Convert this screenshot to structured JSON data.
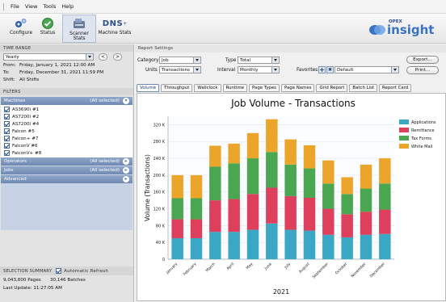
{
  "menu": {
    "items": [
      "File",
      "View",
      "Tools",
      "Help"
    ]
  },
  "toolbar": {
    "buttons": [
      {
        "label": "Configure",
        "icon": "configure-icon"
      },
      {
        "label": "Status",
        "icon": "status-icon"
      },
      {
        "label": "Scanner Stats",
        "icon": "scanner-stats-icon"
      },
      {
        "label": "Machine Stats",
        "icon": "machine-stats-icon",
        "glyph": "DNS"
      }
    ],
    "logo": {
      "small": "OPEX",
      "big": "insight",
      "mark": "opex-logo-icon"
    }
  },
  "left": {
    "time_range": {
      "header": "TIME RANGE",
      "preset": "Yearly",
      "prev": "<",
      "next": ">",
      "from_label": "From:",
      "from_value": "Friday, January 1, 2021 12:00 AM",
      "to_label": "To:",
      "to_value": "Friday, December 31, 2021 11:59 PM",
      "shift_label": "Shift:",
      "shift_value": "All Shifts"
    },
    "filters": {
      "header": "FILTERS",
      "machines": {
        "label": "Machines",
        "summary": "(All selected)",
        "items": [
          "AS3690i #1",
          "AS7200i #2",
          "AS7200i #4",
          "Falcon #5",
          "Falcon+ #7",
          "FalconV #6",
          "FalconV+ #8"
        ]
      },
      "operators": {
        "label": "Operators",
        "summary": "(All selected)"
      },
      "jobs": {
        "label": "Jobs",
        "summary": "(All selected)"
      },
      "advanced": {
        "label": "Advanced"
      }
    },
    "summary": {
      "header": "SELECTION SUMMARY",
      "auto_refresh": "Automatic Refresh",
      "pages": "9,043,800 Pages",
      "batches": "30,146 Batches",
      "last_update": "Last Update: 11:27:05 AM"
    }
  },
  "settings": {
    "header": "Report Settings",
    "category_label": "Category",
    "category_value": "Job",
    "type_label": "Type",
    "type_value": "Total",
    "units_label": "Units",
    "units_value": "Transactions",
    "interval_label": "Interval",
    "interval_value": "Monthly",
    "favorites_label": "Favorites",
    "favorites_value": "Default",
    "add": "+",
    "remove": "✖",
    "export": "Export...",
    "print": "Print..."
  },
  "tabs": [
    "Volume",
    "Throughput",
    "Wallclock",
    "Runtime",
    "Page Types",
    "Page Names",
    "Grid Report",
    "Batch List",
    "Report Card"
  ],
  "active_tab": "Volume",
  "chart_data": {
    "type": "bar",
    "stacked": true,
    "title": "Job Volume - Transactions",
    "xlabel": "2021",
    "ylabel": "Volume (Transactions)",
    "ylim": [
      0,
      340000
    ],
    "ytick_labels": [
      "0",
      "40 K",
      "80 K",
      "120 K",
      "160 K",
      "200 K",
      "240 K",
      "280 K",
      "320 K"
    ],
    "categories": [
      "January",
      "February",
      "March",
      "April",
      "May",
      "June",
      "July",
      "August",
      "September",
      "October",
      "November",
      "December"
    ],
    "series": [
      {
        "name": "Applications",
        "color": "#3aa7c5",
        "values": [
          50000,
          50000,
          65000,
          65000,
          70000,
          85000,
          70000,
          68000,
          58000,
          52000,
          58000,
          60000
        ]
      },
      {
        "name": "Remittance",
        "color": "#de3f5c",
        "values": [
          45000,
          45000,
          75000,
          78000,
          85000,
          85000,
          80000,
          78000,
          62000,
          55000,
          55000,
          58000
        ]
      },
      {
        "name": "Tax Forms",
        "color": "#4aa651",
        "values": [
          50000,
          50000,
          80000,
          85000,
          85000,
          85000,
          75000,
          70000,
          60000,
          48000,
          55000,
          62000
        ]
      },
      {
        "name": "White Mail",
        "color": "#eaa52a",
        "values": [
          55000,
          55000,
          50000,
          47000,
          60000,
          78000,
          60000,
          55000,
          55000,
          40000,
          57000,
          60000
        ]
      }
    ],
    "legend": "right"
  }
}
